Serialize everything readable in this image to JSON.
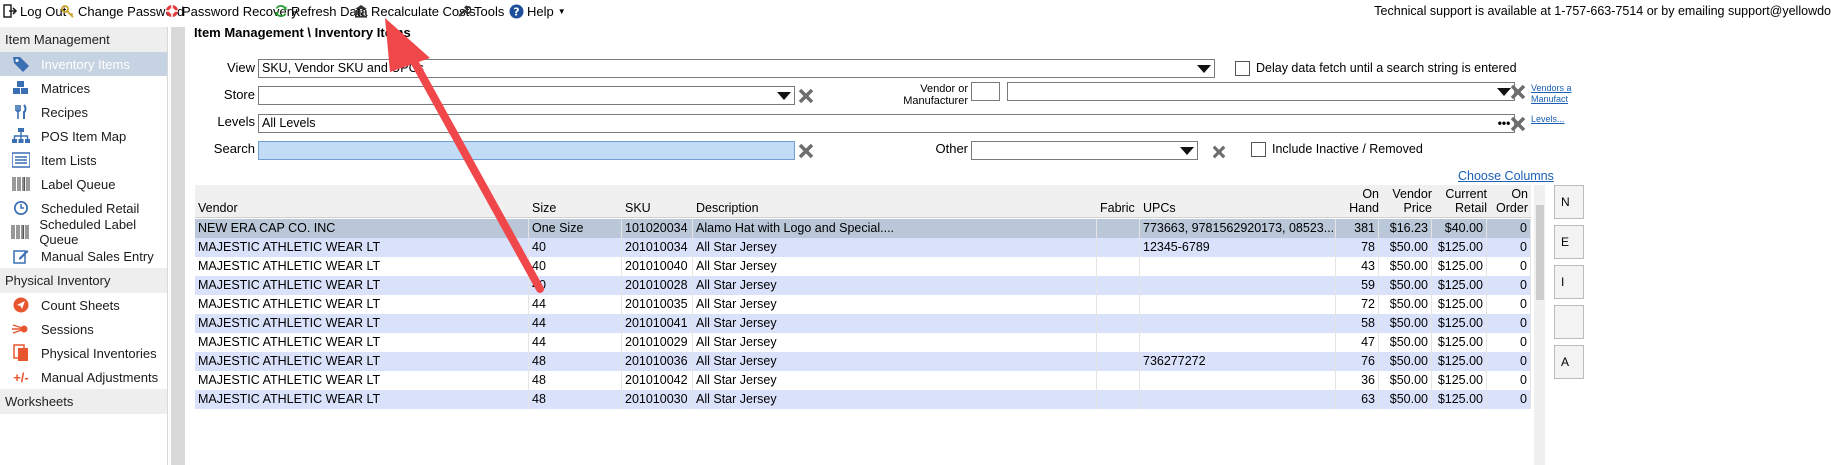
{
  "toolbar": {
    "items": [
      {
        "label": "Log Out",
        "icon": "logout-icon"
      },
      {
        "label": "Change Password",
        "icon": "key-icon"
      },
      {
        "label": "Password Recovery",
        "icon": "lifebuoy-icon"
      },
      {
        "label": "Refresh Data",
        "icon": "refresh-icon"
      },
      {
        "label": "Recalculate Costs",
        "icon": "bank-icon"
      },
      {
        "label": "Tools",
        "icon": "wrench-icon"
      },
      {
        "label": "Help",
        "icon": "help-icon"
      }
    ],
    "support_text": "Technical support is available at 1-757-663-7514 or by emailing support@yellowdo"
  },
  "sidebar": {
    "sections": [
      {
        "title": "Item Management",
        "items": [
          {
            "label": "Inventory Items",
            "icon": "tag-icon",
            "selected": true
          },
          {
            "label": "Matrices",
            "icon": "cubes-icon"
          },
          {
            "label": "Recipes",
            "icon": "fork-knife-icon"
          },
          {
            "label": "POS Item Map",
            "icon": "sitemap-icon"
          },
          {
            "label": "Item Lists",
            "icon": "list-icon"
          },
          {
            "label": "Label Queue",
            "icon": "barcode-icon"
          },
          {
            "label": "Scheduled Retail",
            "icon": "clock-icon"
          },
          {
            "label": "Scheduled Label Queue",
            "icon": "barcode-icon"
          },
          {
            "label": "Manual Sales Entry",
            "icon": "edit-icon"
          }
        ]
      },
      {
        "title": "Physical Inventory",
        "items": [
          {
            "label": "Count Sheets",
            "icon": "send-icon"
          },
          {
            "label": "Sessions",
            "icon": "comet-icon"
          },
          {
            "label": "Physical Inventories",
            "icon": "documents-icon"
          },
          {
            "label": "Manual Adjustments",
            "icon": "plus-minus-icon"
          }
        ]
      },
      {
        "title": "Worksheets",
        "items": []
      }
    ]
  },
  "content": {
    "breadcrumb": "Item Management \\ Inventory Items",
    "filters": {
      "view_label": "View",
      "view_value": "SKU, Vendor SKU and UPCs",
      "delay_label": "Delay data fetch until a search string is entered",
      "store_label": "Store",
      "store_value": "",
      "vendor_label_line1": "Vendor or",
      "vendor_label_line2": "Manufacturer",
      "vendor_code": "",
      "vendor_value": "",
      "vendors_link_line1": "Vendors a",
      "vendors_link_line2": "Manufact",
      "levels_label": "Levels",
      "levels_value": "All Levels",
      "levels_link": "Levels...",
      "search_label": "Search",
      "search_value": "",
      "other_label": "Other",
      "other_value": "",
      "include_inactive_label": "Include Inactive / Removed",
      "choose_columns": "Choose Columns"
    },
    "grid": {
      "headers": {
        "vendor": "Vendor",
        "size": "Size",
        "sku": "SKU",
        "description": "Description",
        "fabric": "Fabric",
        "upcs": "UPCs",
        "on_hand_1": "On",
        "on_hand_2": "Hand",
        "vendor_price_1": "Vendor",
        "vendor_price_2": "Price",
        "current_retail_1": "Current",
        "current_retail_2": "Retail",
        "on_order_1": "On",
        "on_order_2": "Order"
      },
      "rows": [
        {
          "vendor": "NEW ERA CAP CO. INC",
          "size": "One Size",
          "sku": "101020034",
          "description": "Alamo Hat with Logo and Special....",
          "fabric": "",
          "upcs": "773663, 9781562920173, 08523...",
          "on_hand": "381",
          "vendor_price": "$16.23",
          "current_retail": "$40.00",
          "on_order": "0"
        },
        {
          "vendor": "MAJESTIC ATHLETIC WEAR LT",
          "size": "40",
          "sku": "201010034",
          "description": "All Star Jersey",
          "fabric": "",
          "upcs": "12345-6789",
          "on_hand": "78",
          "vendor_price": "$50.00",
          "current_retail": "$125.00",
          "on_order": "0"
        },
        {
          "vendor": "MAJESTIC ATHLETIC WEAR LT",
          "size": "40",
          "sku": "201010040",
          "description": "All Star Jersey",
          "fabric": "",
          "upcs": "",
          "on_hand": "43",
          "vendor_price": "$50.00",
          "current_retail": "$125.00",
          "on_order": "0"
        },
        {
          "vendor": "MAJESTIC ATHLETIC WEAR LT",
          "size": "40",
          "sku": "201010028",
          "description": "All Star Jersey",
          "fabric": "",
          "upcs": "",
          "on_hand": "59",
          "vendor_price": "$50.00",
          "current_retail": "$125.00",
          "on_order": "0"
        },
        {
          "vendor": "MAJESTIC ATHLETIC WEAR LT",
          "size": "44",
          "sku": "201010035",
          "description": "All Star Jersey",
          "fabric": "",
          "upcs": "",
          "on_hand": "72",
          "vendor_price": "$50.00",
          "current_retail": "$125.00",
          "on_order": "0"
        },
        {
          "vendor": "MAJESTIC ATHLETIC WEAR LT",
          "size": "44",
          "sku": "201010041",
          "description": "All Star Jersey",
          "fabric": "",
          "upcs": "",
          "on_hand": "58",
          "vendor_price": "$50.00",
          "current_retail": "$125.00",
          "on_order": "0"
        },
        {
          "vendor": "MAJESTIC ATHLETIC WEAR LT",
          "size": "44",
          "sku": "201010029",
          "description": "All Star Jersey",
          "fabric": "",
          "upcs": "",
          "on_hand": "47",
          "vendor_price": "$50.00",
          "current_retail": "$125.00",
          "on_order": "0"
        },
        {
          "vendor": "MAJESTIC ATHLETIC WEAR LT",
          "size": "48",
          "sku": "201010036",
          "description": "All Star Jersey",
          "fabric": "",
          "upcs": "736277272",
          "on_hand": "76",
          "vendor_price": "$50.00",
          "current_retail": "$125.00",
          "on_order": "0"
        },
        {
          "vendor": "MAJESTIC ATHLETIC WEAR LT",
          "size": "48",
          "sku": "201010042",
          "description": "All Star Jersey",
          "fabric": "",
          "upcs": "",
          "on_hand": "36",
          "vendor_price": "$50.00",
          "current_retail": "$125.00",
          "on_order": "0"
        },
        {
          "vendor": "MAJESTIC ATHLETIC WEAR LT",
          "size": "48",
          "sku": "201010030",
          "description": "All Star Jersey",
          "fabric": "",
          "upcs": "",
          "on_hand": "63",
          "vendor_price": "$50.00",
          "current_retail": "$125.00",
          "on_order": "0"
        }
      ]
    },
    "edge_buttons": [
      "N",
      "E",
      "I",
      "",
      "A"
    ]
  },
  "colors": {
    "accent_blue": "#1a5fb4",
    "selected_row": "#b9c7d8",
    "alt_row": "#d9e2fa",
    "arrow_red": "#f0474a",
    "clear_x": "#6d6d6d"
  }
}
